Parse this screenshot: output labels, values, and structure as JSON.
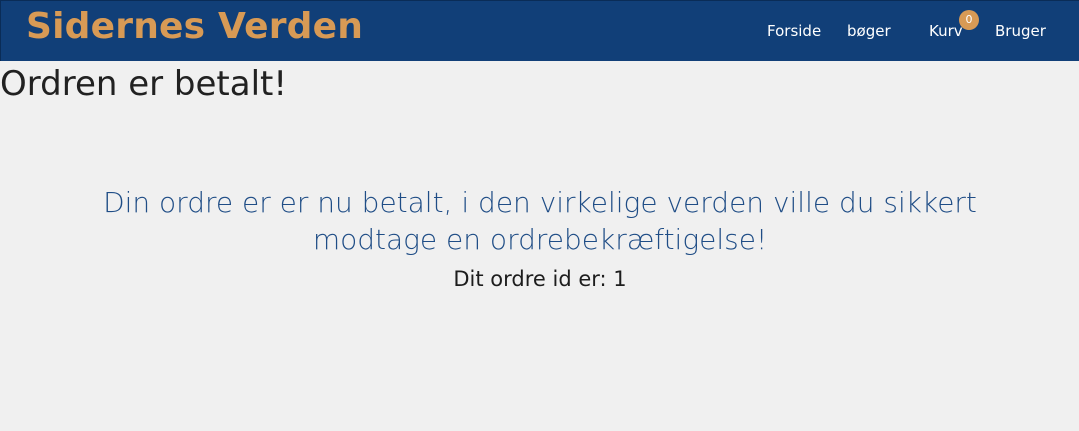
{
  "header": {
    "brand": "Sidernes Verden",
    "nav": {
      "home": "Forside",
      "books": "bøger",
      "cart": "Kurv",
      "user": "Bruger"
    },
    "cart_count": "0"
  },
  "main": {
    "title": "Ordren er betalt!",
    "message": "Din ordre er er nu betalt, i den virkelige verden ville du sikkert modtage en ordrebekræftigelse!",
    "order_id_text": "Dit ordre id er: 1"
  },
  "colors": {
    "navbar": "#113f78",
    "brand": "#d89a55",
    "background": "#f0f0f0",
    "message": "#1f4d86"
  }
}
